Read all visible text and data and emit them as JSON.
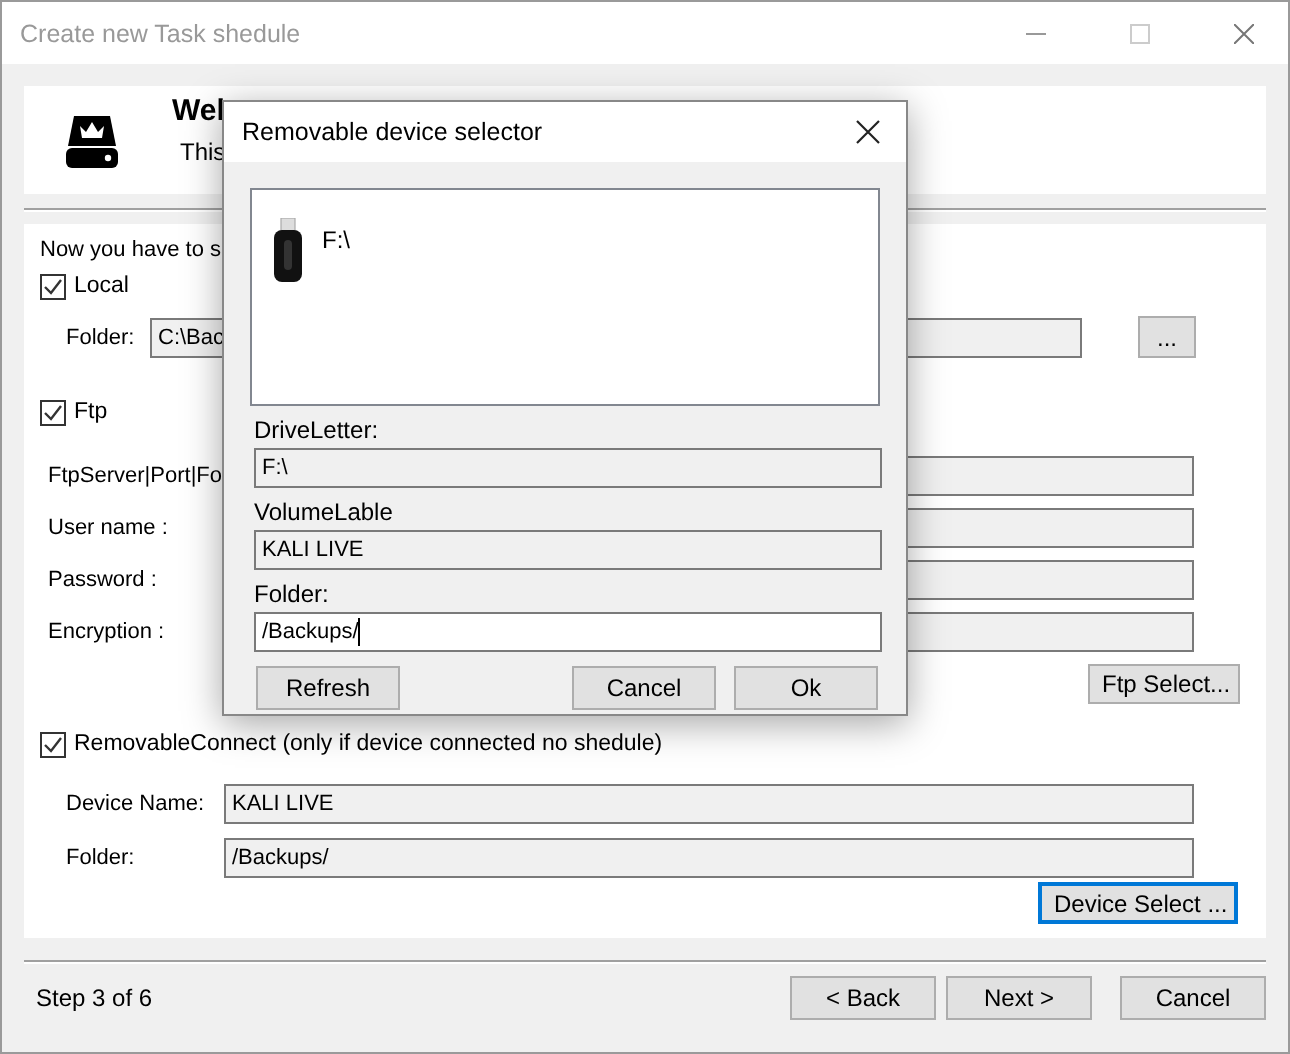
{
  "window": {
    "title": "Create new Task shedule"
  },
  "header": {
    "title": "Wel",
    "subtitle": "This"
  },
  "intro": "Now you have to s",
  "local": {
    "label": "Local",
    "checked": true,
    "folder_label": "Folder:",
    "folder_value": "C:\\Bac",
    "browse_button": "..."
  },
  "ftp": {
    "label": "Ftp",
    "checked": true,
    "fields": [
      {
        "label": "FtpServer|Port|Fo"
      },
      {
        "label": "User name :"
      },
      {
        "label": "Password :"
      },
      {
        "label": "Encryption :"
      }
    ],
    "select_button": {
      "label": "Ftp Select...",
      "focused": false
    }
  },
  "removable": {
    "label": "RemovableConnect (only if device connected no shedule)",
    "checked": true,
    "fields": [
      {
        "label": "Device Name:",
        "value": "KALI LIVE"
      },
      {
        "label": "Folder:",
        "value": "/Backups/"
      }
    ],
    "select_button": {
      "label": "Device Select ...",
      "focused": true
    }
  },
  "footer": {
    "step": "Step 3 of 6",
    "buttons": [
      "< Back",
      "Next >",
      "Cancel"
    ]
  },
  "dialog": {
    "title": "Removable device selector",
    "devices": [
      {
        "label": "F:\\"
      }
    ],
    "fields": [
      {
        "label": "DriveLetter:",
        "value": "F:\\",
        "readonly": true
      },
      {
        "label": "VolumeLable",
        "value": "KALI LIVE",
        "readonly": true
      },
      {
        "label": "Folder:",
        "value": "/Backups/",
        "readonly": false
      }
    ],
    "buttons": [
      "Refresh",
      "Cancel",
      "Ok"
    ]
  }
}
